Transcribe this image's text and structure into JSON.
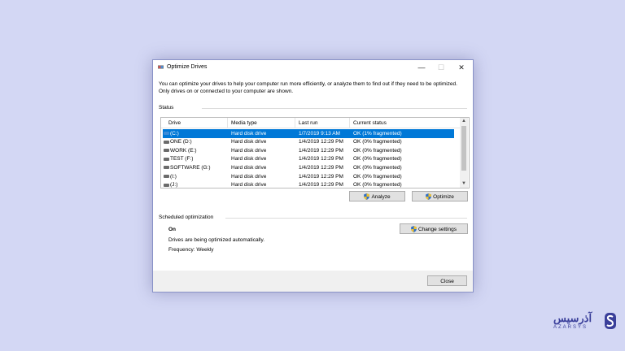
{
  "window": {
    "title": "Optimize Drives",
    "minimize_glyph": "—",
    "maximize_glyph": "☐",
    "close_glyph": "✕"
  },
  "description": "You can optimize your drives to help your computer run more efficiently, or analyze them to find out if they need to be optimized. Only drives on or connected to your computer are shown.",
  "status": {
    "label": "Status",
    "columns": [
      "Drive",
      "Media type",
      "Last run",
      "Current status"
    ],
    "rows": [
      {
        "drive": "(C:)",
        "icon": "system-drive-icon",
        "media": "Hard disk drive",
        "last_run": "1/7/2019 9:13 AM",
        "status": "OK (1% fragmented)",
        "selected": true
      },
      {
        "drive": "ONE (D:)",
        "icon": "drive-icon",
        "media": "Hard disk drive",
        "last_run": "1/4/2019 12:29 PM",
        "status": "OK (0% fragmented)",
        "selected": false
      },
      {
        "drive": "WORK (E:)",
        "icon": "drive-icon",
        "media": "Hard disk drive",
        "last_run": "1/4/2019 12:29 PM",
        "status": "OK (0% fragmented)",
        "selected": false
      },
      {
        "drive": "TEST (F:)",
        "icon": "drive-icon",
        "media": "Hard disk drive",
        "last_run": "1/4/2019 12:29 PM",
        "status": "OK (0% fragmented)",
        "selected": false
      },
      {
        "drive": "SOFTWARE (G:)",
        "icon": "drive-icon",
        "media": "Hard disk drive",
        "last_run": "1/4/2019 12:29 PM",
        "status": "OK (0% fragmented)",
        "selected": false
      },
      {
        "drive": "(I:)",
        "icon": "drive-icon",
        "media": "Hard disk drive",
        "last_run": "1/4/2019 12:29 PM",
        "status": "OK (0% fragmented)",
        "selected": false
      },
      {
        "drive": "(J:)",
        "icon": "drive-icon",
        "media": "Hard disk drive",
        "last_run": "1/4/2019 12:29 PM",
        "status": "OK (0% fragmented)",
        "selected": false
      }
    ],
    "analyze_label": "Analyze",
    "optimize_label": "Optimize"
  },
  "scheduled": {
    "label": "Scheduled optimization",
    "state": "On",
    "message": "Drives are being optimized automatically.",
    "frequency": "Frequency: Weekly",
    "change_settings_label": "Change settings"
  },
  "footer": {
    "close_label": "Close"
  },
  "watermark": {
    "main": "آذرسیس",
    "sub": "AZARSYS"
  },
  "colors": {
    "background": "#d3d7f4",
    "selection": "#0078d7",
    "brand": "#3a3f9a"
  }
}
